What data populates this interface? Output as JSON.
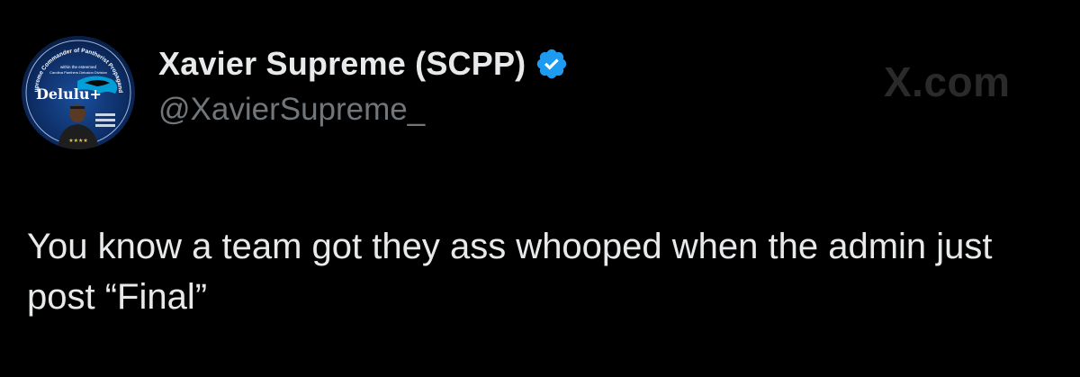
{
  "author": {
    "display_name": "Xavier Supreme (SCPP)",
    "handle": "@XavierSupreme_",
    "verified": true,
    "badge_color": "#1d9bf0",
    "avatar": {
      "ring_text": "Supreme Commander of Pantherist Propaganda",
      "inner_text_1": "within the esteemed",
      "inner_text_2": "Carolina Panthers Delusion Division",
      "logo_text": "Delulu+",
      "stars": "★★★★"
    }
  },
  "watermark": "X.com",
  "tweet": {
    "text": "You know a team got they ass whooped when the admin just post “Final”"
  },
  "colors": {
    "background": "#000000",
    "name": "#e7e9ea",
    "handle": "#71767b",
    "text": "#e7e9ea"
  }
}
